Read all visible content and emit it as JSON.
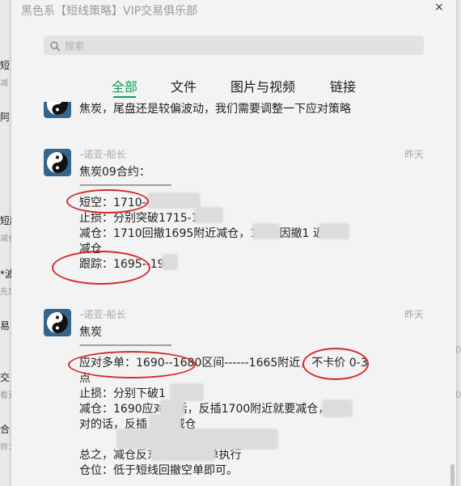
{
  "window": {
    "title": "黑色系【短线策略】VIP交易俱乐部",
    "close_label": "×"
  },
  "search": {
    "placeholder": "搜索"
  },
  "tabs": [
    {
      "label": "全部",
      "active": true
    },
    {
      "label": "文件"
    },
    {
      "label": "图片与视频"
    },
    {
      "label": "链接"
    }
  ],
  "messages": [
    {
      "text": "焦炭，尾盘还是较偏波动，我们需要调整一下应对策略"
    },
    {
      "sender": "-诺亚-船长",
      "time": "昨天",
      "lines": [
        "焦炭09合约：",
        "----------------------------",
        "短空：1710--1",
        "止损：分别突破1715-1",
        "减仓：1710回撤1695附近减仓，17      近因撤1      近",
        "减仓",
        "跟踪：1695--19"
      ]
    },
    {
      "sender": "-诺亚-船长",
      "time": "昨天",
      "lines": [
        "焦炭",
        "----------------------------",
        "应对多单：1690--1680区间------1665附近，不卡价 0-3",
        "点",
        "止损：分别下破1",
        "减仓：1690应对的话，反插1700附近就要减仓，      应",
        "对的话，反插      附近减仓",
        "",
        "总之，减仓反东      点区间减单执行",
        "仓位：低于短线回撤空单即可。"
      ]
    }
  ],
  "background": {
    "left_fragments": [
      "短",
      "减",
      "阿",
      "短段",
      "减仓",
      "*波",
      "先加",
      "易",
      "交",
      "看元",
      "合",
      "师："
    ],
    "right_fragments": [
      "10",
      "10"
    ]
  },
  "colors": {
    "accent": "#07a15a",
    "annotation": "#d42a2a",
    "avatar": "#36658b"
  }
}
